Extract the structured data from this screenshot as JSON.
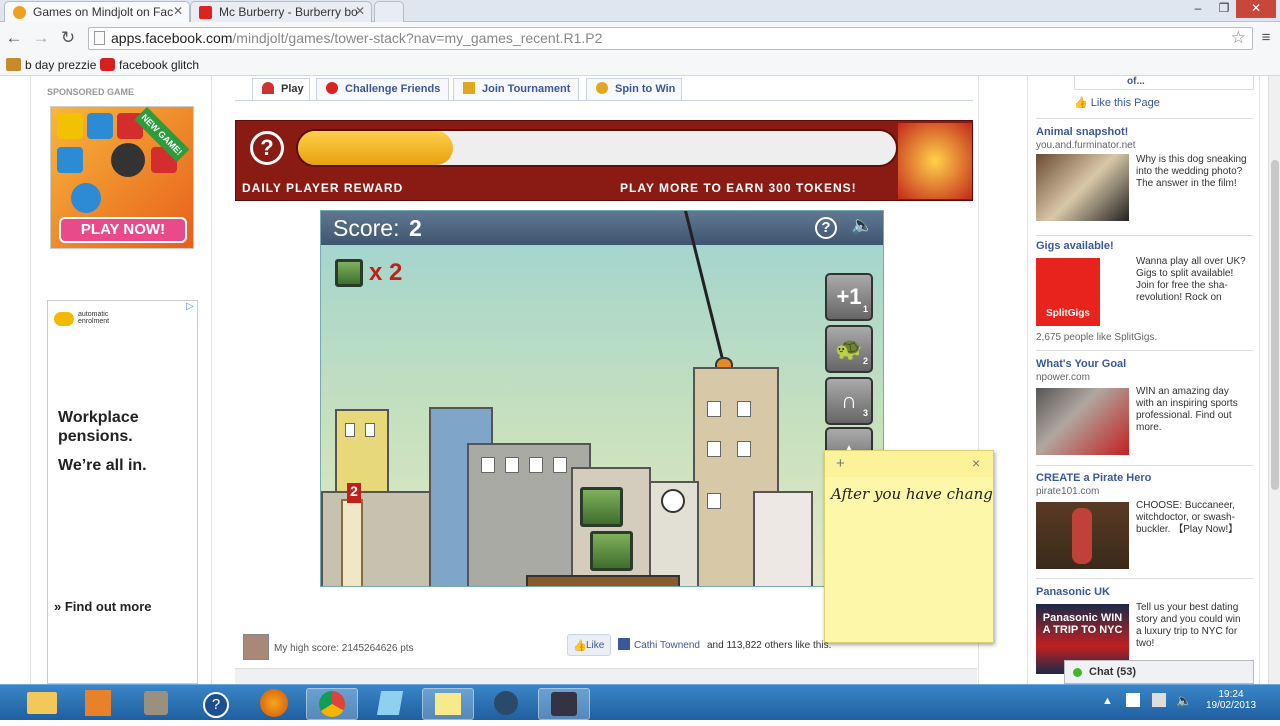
{
  "browser": {
    "tabs": [
      {
        "title": "Games on Mindjolt on Fac",
        "active": true
      },
      {
        "title": "Mc Burberry - Burberry bo",
        "active": false
      }
    ],
    "url_host": "apps.facebook.com",
    "url_path": "/mindjolt/games/tower-stack?nav=my_games_recent.R1.P2",
    "bookmarks": [
      {
        "label": "b day prezzie",
        "icon": "folder-icon"
      },
      {
        "label": "facebook glitch",
        "icon": "youtube-icon"
      }
    ]
  },
  "left": {
    "sponsored_label": "SPONSORED GAME",
    "game_badge": "NEW GAME!",
    "play_now": "PLAY NOW!",
    "ad_brand": "automatic enrolment",
    "ad_lines": [
      "Workplace",
      "pensions.",
      "We’re all in."
    ],
    "find_out_more": "» Find out more"
  },
  "game_tabs": [
    {
      "label": "Play",
      "selected": true
    },
    {
      "label": "Challenge Friends",
      "selected": false
    },
    {
      "label": "Join Tournament",
      "selected": false
    },
    {
      "label": "Spin to Win",
      "selected": false
    }
  ],
  "reward": {
    "left_text": "DAILY PLAYER REWARD",
    "right_text": "PLAY MORE TO EARN 300 TOKENS!",
    "progress": 0.26,
    "help": "?"
  },
  "game": {
    "score_label": "Score:",
    "score_value": "2",
    "multiplier": "x 2",
    "height_marker": "2",
    "powerups": [
      {
        "label": "+1",
        "count": "1"
      },
      {
        "label": "",
        "count": "2",
        "icon": "turtle-icon"
      },
      {
        "label": "",
        "count": "3",
        "icon": "magnet-icon"
      }
    ]
  },
  "sticky": {
    "plus": "+",
    "close": "×",
    "text": "After you have chang"
  },
  "footer": {
    "high_score": "My high score: 2145264626 pts",
    "like_button": "Like",
    "like_text_name": "Cathi Townend",
    "like_text_rest": "and 113,822 others like this."
  },
  "right": {
    "top_partial": "of...",
    "like_page": "Like this Page",
    "ads": [
      {
        "title": "Animal snapshot!",
        "url": "you.and.furminator.net",
        "body": "Why is this dog sneaking into the wedding photo? The answer in the film!",
        "extra": ""
      },
      {
        "title": "Gigs available!",
        "url": "",
        "body": "Wanna play all over UK? Gigs to split available! Join for free the sha-revolution! Rock on",
        "extra": "2,675 people like SplitGigs.",
        "img_text": "SplitGigs"
      },
      {
        "title": "What's Your Goal",
        "url": "npower.com",
        "body": "WIN an amazing day with an inspiring sports professional. Find out more.",
        "extra": ""
      },
      {
        "title": "CREATE a Pirate Hero",
        "url": "pirate101.com",
        "body": "CHOOSE: Buccaneer, witchdoctor, or swash-buckler. 【Play Now!】",
        "extra": ""
      },
      {
        "title": "Panasonic UK",
        "url": "",
        "body": "Tell us your best dating story and you could win a luxury trip to NYC for two!",
        "extra": "",
        "img_text": "Panasonic WIN A TRIP TO NYC"
      }
    ],
    "chat": "Chat (53)"
  },
  "taskbar": {
    "time": "19:24",
    "date": "19/02/2013"
  },
  "colors": {
    "fb_blue": "#3b5998",
    "reward_red": "#8a1b12",
    "progress_yellow": "#f4b41a",
    "taskbar": "#2a6fb0"
  }
}
